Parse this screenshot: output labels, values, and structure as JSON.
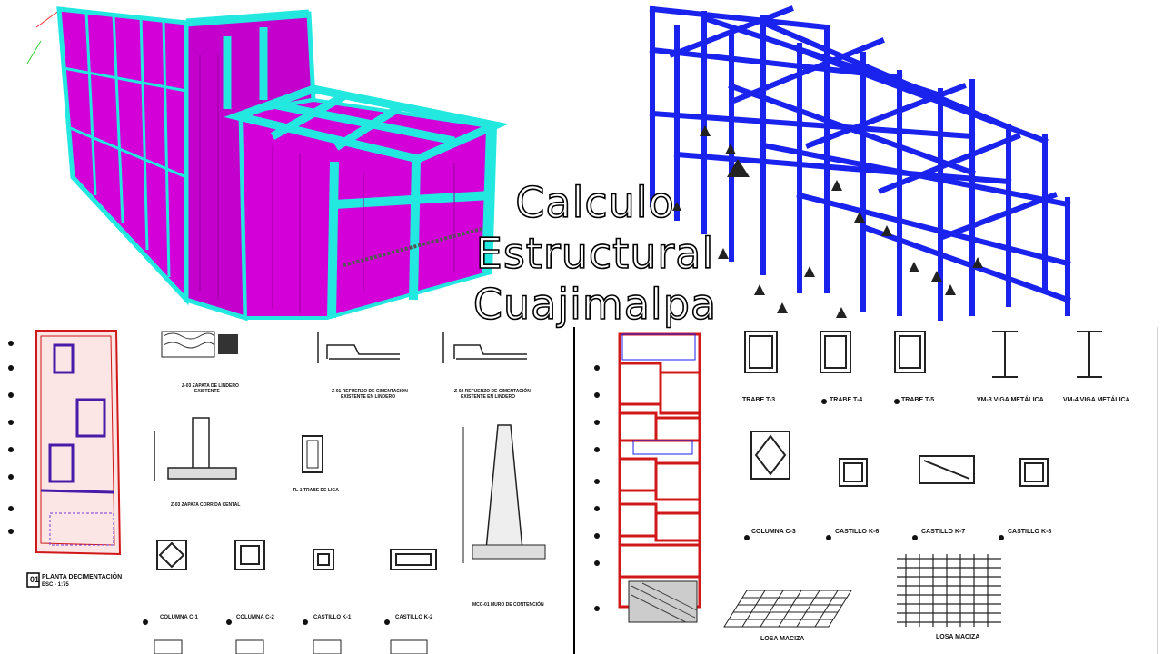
{
  "title": {
    "line1": "Calculo",
    "line2": "Estructural",
    "line3": "Cuajimalpa"
  },
  "colors": {
    "magenta": "#d300d8",
    "cyan": "#22e8e0",
    "blue": "#1a22ee",
    "red": "#d01818",
    "purple": "#4a1aa8"
  },
  "left_sheet": {
    "plan_number": "01",
    "plan_title": "PLANTA DECIMENTACIÓN",
    "plan_scale": "ESC - 1:75",
    "details": {
      "z03_title": "Z-03 ZAPATA DE LINDERO",
      "z03_sub": "EXISTENTE",
      "z01_title": "Z-01 REFUERZO DE CIMENTACIÓN",
      "z01_sub": "EXISTENTE EN LINDERO",
      "z02_title": "Z-02 REFUERZO DE CIMENTACIÓN",
      "z02_sub": "EXISTENTE EN LINDERO",
      "z03b_title": "Z-03 ZAPATA CORRIDA CENTAL",
      "tl1_title": "TL-1 TRABE DE LIGA",
      "mcc_title": "MCC-01 MURO DE CONTENCIÓN",
      "c1_title": "COLUMNA C-1",
      "c2_title": "COLUMNA C-2",
      "k1_title": "CASTILLO K-1",
      "k2_title": "CASTILLO K-2"
    }
  },
  "right_sheet": {
    "details": {
      "t3_title": "TRABE T-3",
      "t4_title": "TRABE T-4",
      "t5_title": "TRABE T-5",
      "vm3_title": "VM-3 VIGA METÁLICA",
      "vm4_title": "VM-4 VIGA METÁLICA",
      "c3_title": "COLUMNA C-3",
      "k6_title": "CASTILLO K-6",
      "k7_title": "CASTILLO K-7",
      "k8_title": "CASTILLO K-8",
      "losa1_title": "LOSA MACIZA",
      "losa2_title": "LOSA MACIZA"
    }
  }
}
